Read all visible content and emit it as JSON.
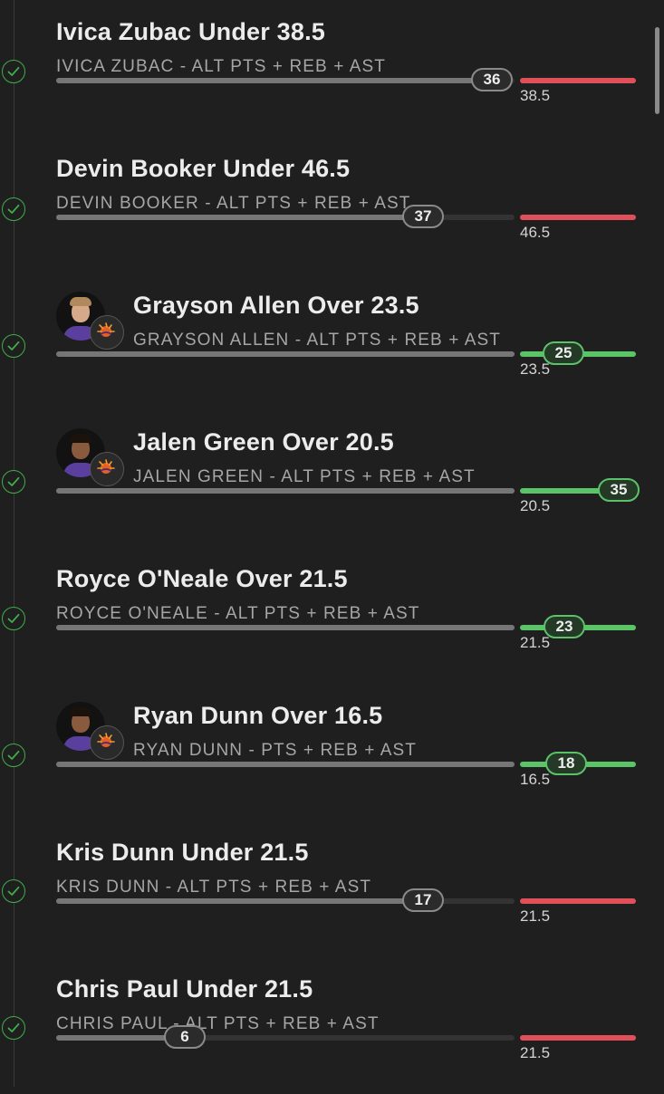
{
  "colors": {
    "over": "#5bc466",
    "under": "#e0505a",
    "check": "#3fae48",
    "bar": "#767676"
  },
  "legs": [
    {
      "title": "Ivica Zubac Under 38.5",
      "market": "IVICA ZUBAC - ALT PTS + REB + AST",
      "line": "38.5",
      "actual": "36",
      "direction": "under",
      "progress": 0.95,
      "avatar": false
    },
    {
      "title": "Devin Booker Under 46.5",
      "market": "DEVIN BOOKER - ALT PTS + REB + AST",
      "line": "46.5",
      "actual": "37",
      "direction": "under",
      "progress": 0.8,
      "avatar": false
    },
    {
      "title": "Grayson Allen Over 23.5",
      "market": "GRAYSON ALLEN - ALT PTS + REB + AST",
      "line": "23.5",
      "actual": "25",
      "direction": "over",
      "progress": 1.0,
      "avatar": true,
      "player_icon": "player-headshot",
      "team_icon": "suns-logo-icon"
    },
    {
      "title": "Jalen Green Over 20.5",
      "market": "JALEN GREEN - ALT PTS + REB + AST",
      "line": "20.5",
      "actual": "35",
      "direction": "over",
      "progress": 1.0,
      "avatar": true,
      "player_icon": "player-headshot",
      "team_icon": "suns-logo-icon"
    },
    {
      "title": "Royce O'Neale Over 21.5",
      "market": "ROYCE O'NEALE - ALT PTS + REB + AST",
      "line": "21.5",
      "actual": "23",
      "direction": "over",
      "progress": 1.0,
      "avatar": false
    },
    {
      "title": "Ryan Dunn Over 16.5",
      "market": "RYAN DUNN - PTS + REB + AST",
      "line": "16.5",
      "actual": "18",
      "direction": "over",
      "progress": 1.0,
      "avatar": true,
      "player_icon": "player-headshot",
      "team_icon": "suns-logo-icon"
    },
    {
      "title": "Kris Dunn Under 21.5",
      "market": "KRIS DUNN - ALT PTS + REB + AST",
      "line": "21.5",
      "actual": "17",
      "direction": "under",
      "progress": 0.8,
      "avatar": false
    },
    {
      "title": "Chris Paul Under 21.5",
      "market": "CHRIS PAUL - ALT PTS + REB + AST",
      "line": "21.5",
      "actual": "6",
      "direction": "under",
      "progress": 0.28,
      "avatar": false
    }
  ]
}
